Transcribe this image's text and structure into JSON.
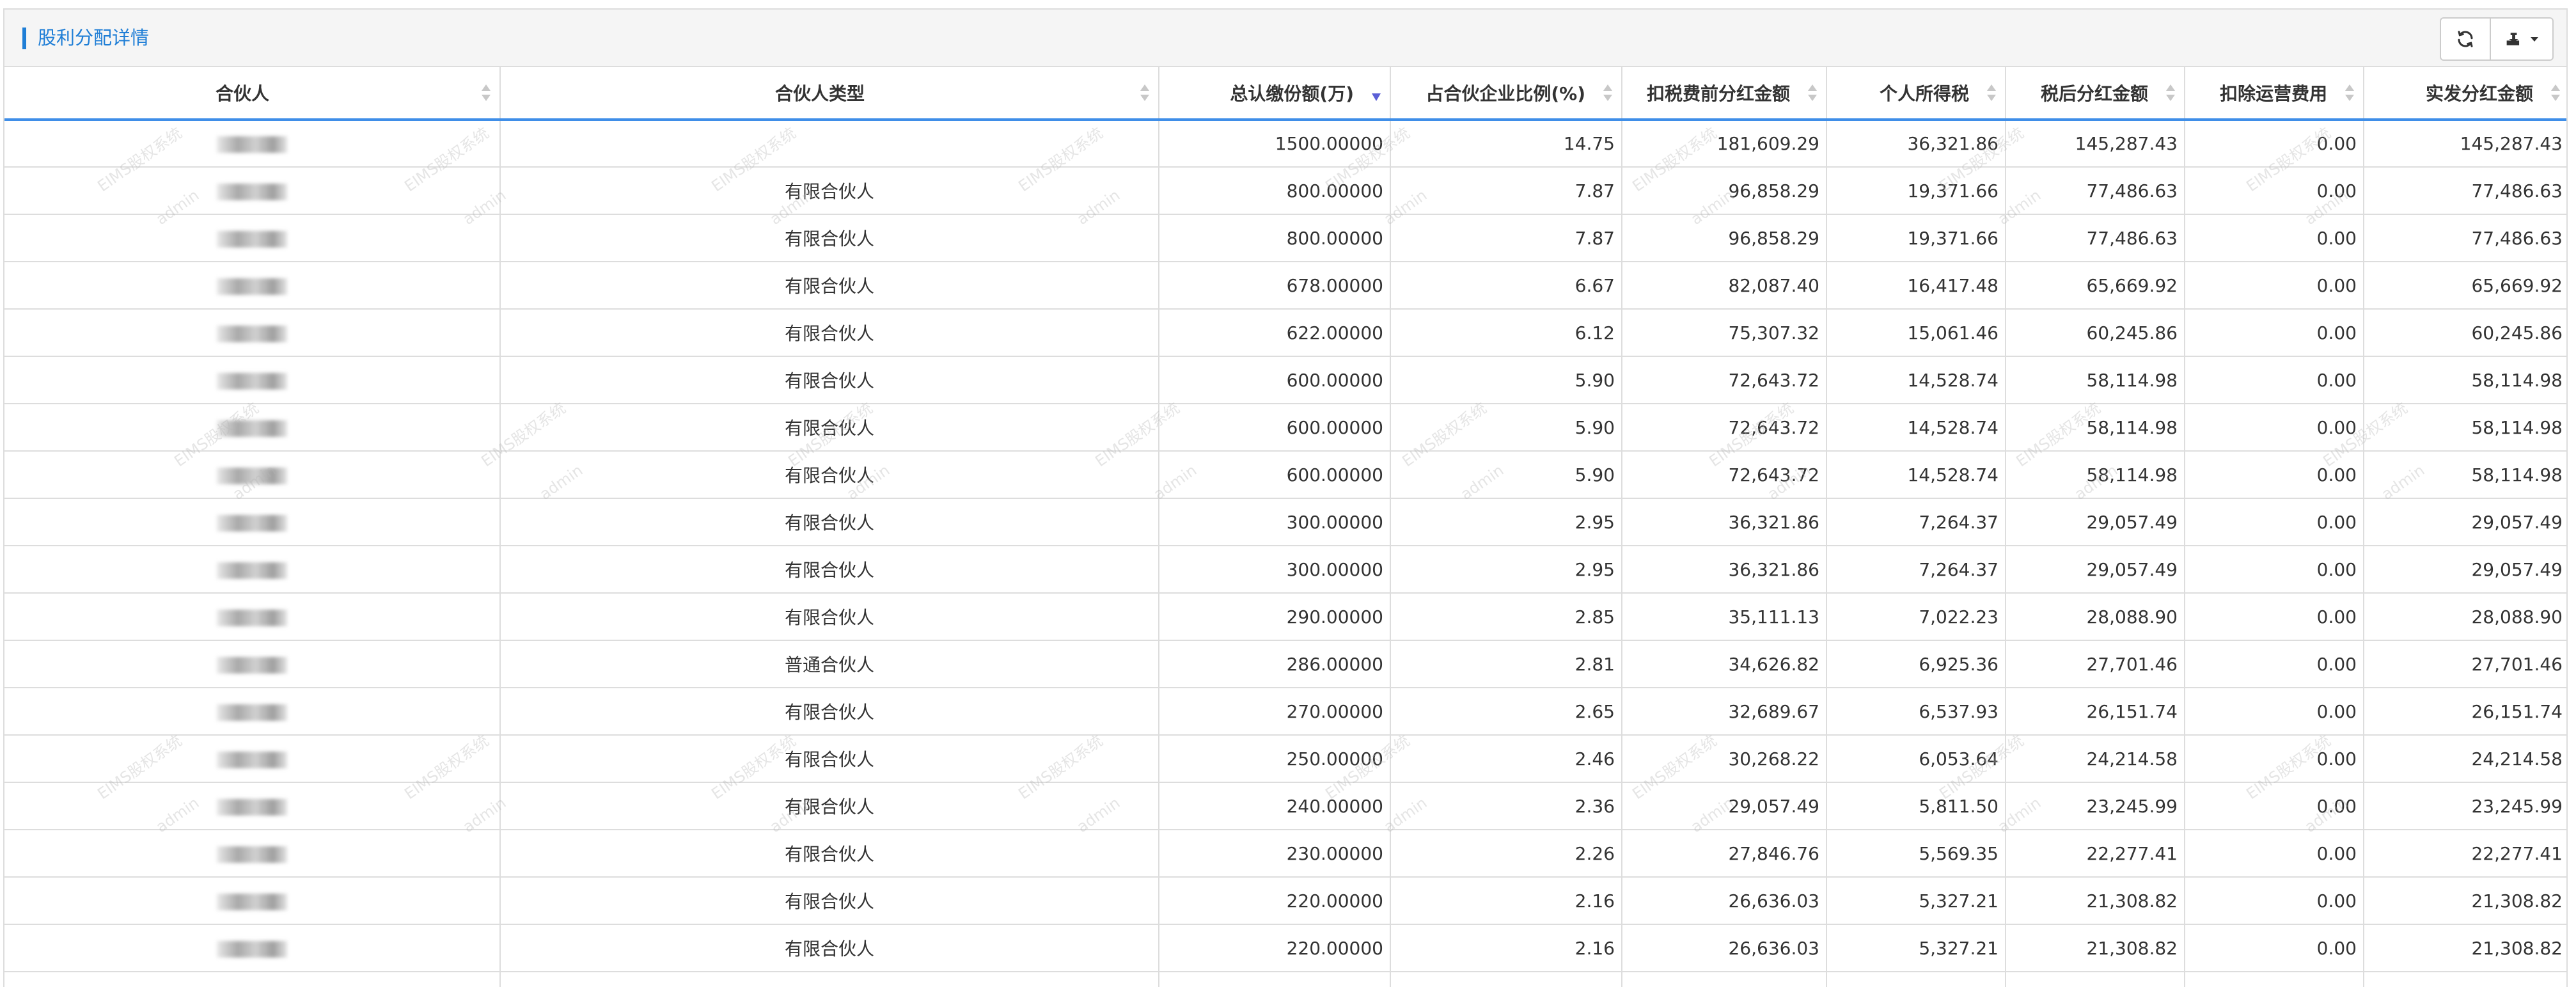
{
  "panel": {
    "title": "股利分配详情",
    "refresh_icon": "refresh-icon",
    "export_icon": "export-icon"
  },
  "watermark": {
    "system": "EIMS股权系统",
    "user": "admin"
  },
  "table": {
    "columns": [
      {
        "label": "合伙人",
        "sort": "none"
      },
      {
        "label": "合伙人类型",
        "sort": "none"
      },
      {
        "label": "总认缴份额(万)",
        "sort": "desc"
      },
      {
        "label": "占合伙企业比例(%)",
        "sort": "none"
      },
      {
        "label": "扣税费前分红金额",
        "sort": "none"
      },
      {
        "label": "个人所得税",
        "sort": "none"
      },
      {
        "label": "税后分红金额",
        "sort": "none"
      },
      {
        "label": "扣除运营费用",
        "sort": "none"
      },
      {
        "label": "实发分红金额",
        "sort": "none"
      }
    ],
    "rows": [
      [
        "",
        "",
        "1500.00000",
        "14.75",
        "181,609.29",
        "36,321.86",
        "145,287.43",
        "0.00",
        "145,287.43"
      ],
      [
        "",
        "有限合伙人",
        "800.00000",
        "7.87",
        "96,858.29",
        "19,371.66",
        "77,486.63",
        "0.00",
        "77,486.63"
      ],
      [
        "",
        "有限合伙人",
        "800.00000",
        "7.87",
        "96,858.29",
        "19,371.66",
        "77,486.63",
        "0.00",
        "77,486.63"
      ],
      [
        "",
        "有限合伙人",
        "678.00000",
        "6.67",
        "82,087.40",
        "16,417.48",
        "65,669.92",
        "0.00",
        "65,669.92"
      ],
      [
        "",
        "有限合伙人",
        "622.00000",
        "6.12",
        "75,307.32",
        "15,061.46",
        "60,245.86",
        "0.00",
        "60,245.86"
      ],
      [
        "",
        "有限合伙人",
        "600.00000",
        "5.90",
        "72,643.72",
        "14,528.74",
        "58,114.98",
        "0.00",
        "58,114.98"
      ],
      [
        "",
        "有限合伙人",
        "600.00000",
        "5.90",
        "72,643.72",
        "14,528.74",
        "58,114.98",
        "0.00",
        "58,114.98"
      ],
      [
        "",
        "有限合伙人",
        "600.00000",
        "5.90",
        "72,643.72",
        "14,528.74",
        "58,114.98",
        "0.00",
        "58,114.98"
      ],
      [
        "",
        "有限合伙人",
        "300.00000",
        "2.95",
        "36,321.86",
        "7,264.37",
        "29,057.49",
        "0.00",
        "29,057.49"
      ],
      [
        "",
        "有限合伙人",
        "300.00000",
        "2.95",
        "36,321.86",
        "7,264.37",
        "29,057.49",
        "0.00",
        "29,057.49"
      ],
      [
        "",
        "有限合伙人",
        "290.00000",
        "2.85",
        "35,111.13",
        "7,022.23",
        "28,088.90",
        "0.00",
        "28,088.90"
      ],
      [
        "",
        "普通合伙人",
        "286.00000",
        "2.81",
        "34,626.82",
        "6,925.36",
        "27,701.46",
        "0.00",
        "27,701.46"
      ],
      [
        "",
        "有限合伙人",
        "270.00000",
        "2.65",
        "32,689.67",
        "6,537.93",
        "26,151.74",
        "0.00",
        "26,151.74"
      ],
      [
        "",
        "有限合伙人",
        "250.00000",
        "2.46",
        "30,268.22",
        "6,053.64",
        "24,214.58",
        "0.00",
        "24,214.58"
      ],
      [
        "",
        "有限合伙人",
        "240.00000",
        "2.36",
        "29,057.49",
        "5,811.50",
        "23,245.99",
        "0.00",
        "23,245.99"
      ],
      [
        "",
        "有限合伙人",
        "230.00000",
        "2.26",
        "27,846.76",
        "5,569.35",
        "22,277.41",
        "0.00",
        "22,277.41"
      ],
      [
        "",
        "有限合伙人",
        "220.00000",
        "2.16",
        "26,636.03",
        "5,327.21",
        "21,308.82",
        "0.00",
        "21,308.82"
      ],
      [
        "",
        "有限合伙人",
        "220.00000",
        "2.16",
        "26,636.03",
        "5,327.21",
        "21,308.82",
        "0.00",
        "21,308.82"
      ],
      [
        "",
        "",
        "",
        "",
        "",
        "",
        "",
        "",
        ""
      ]
    ]
  }
}
